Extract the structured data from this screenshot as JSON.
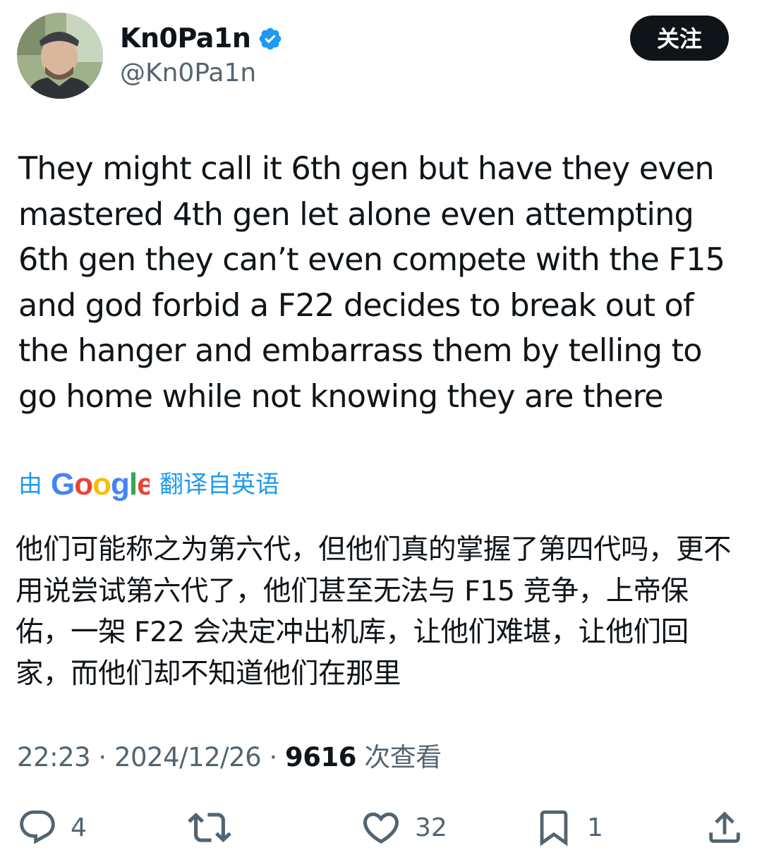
{
  "author": {
    "display_name": "Kn0Pa1n",
    "handle": "@Kn0Pa1n",
    "avatar_icon": "avatar-photo",
    "verified_icon": "verified-badge-icon"
  },
  "follow_button_label": "关注",
  "tweet": {
    "text": "They might call it 6th gen but have they even mastered 4th gen let alone even attempting 6th gen they can’t even compete with the F15 and god forbid a F22 decides to break out of the hanger and embarrass them by telling to go home while not knowing they are there"
  },
  "translation": {
    "prefix": "由",
    "provider": "Google",
    "suffix": "翻译自英语",
    "text": "他们可能称之为第六代，但他们真的掌握了第四代吗，更不用说尝试第六代了，他们甚至无法与 F15 竞争，上帝保佑，一架 F22 会决定冲出机库，让他们难堪，让他们回家，而他们却不知道他们在那里"
  },
  "meta": {
    "time": "22:23",
    "separator": "·",
    "date": "2024/12/26",
    "views": "9616",
    "views_label": "次查看"
  },
  "actions": {
    "reply_count": "4",
    "retweet_count": "",
    "like_count": "32",
    "bookmark_count": "1"
  },
  "colors": {
    "accent": "#1d9bf0",
    "text": "#0f1419",
    "secondary": "#536471"
  }
}
